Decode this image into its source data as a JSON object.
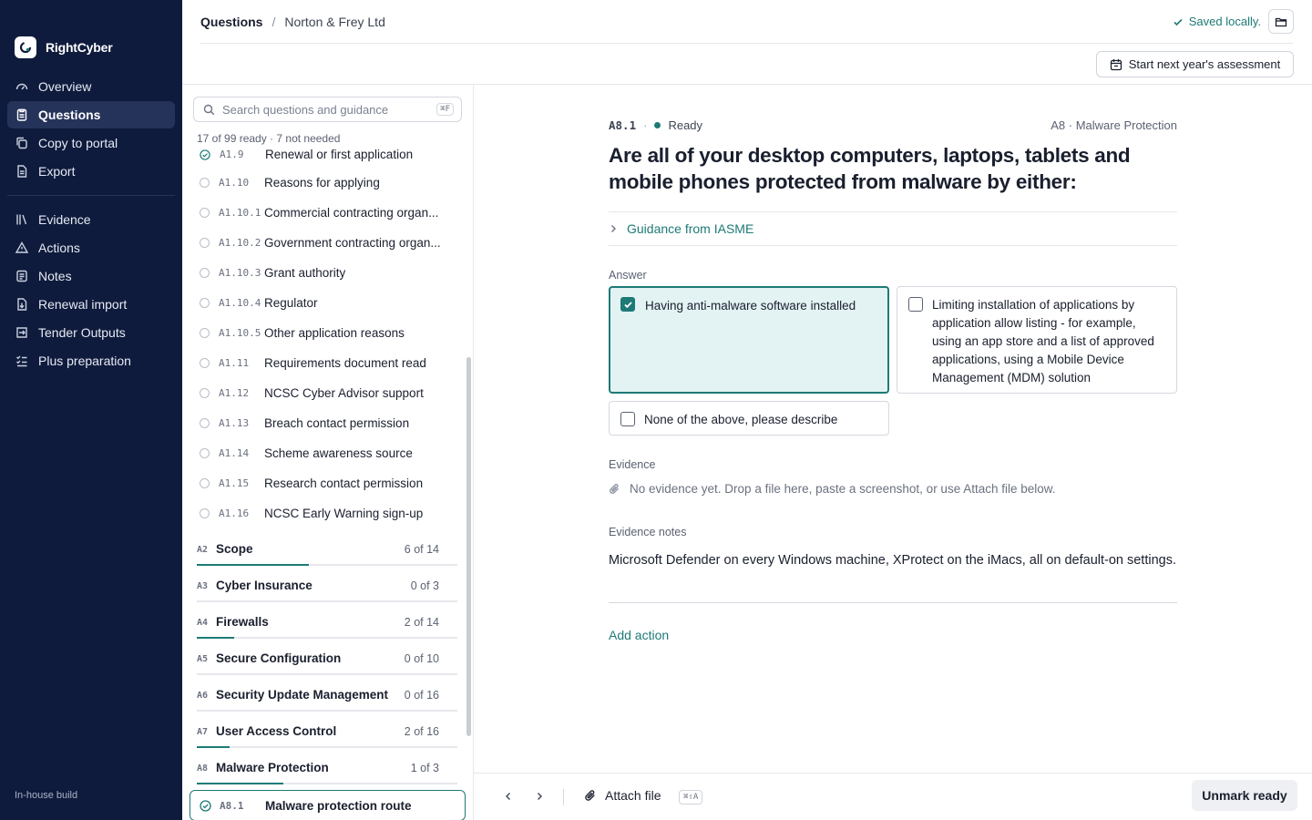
{
  "brand": {
    "name": "RightCyber"
  },
  "sidebar": {
    "nav_primary": [
      {
        "label": "Overview",
        "icon": "gauge-icon"
      },
      {
        "label": "Questions",
        "icon": "clipboard-icon",
        "active": true
      },
      {
        "label": "Copy to portal",
        "icon": "copy-icon"
      },
      {
        "label": "Export",
        "icon": "document-icon"
      }
    ],
    "nav_secondary": [
      {
        "label": "Evidence",
        "icon": "library-icon"
      },
      {
        "label": "Actions",
        "icon": "warning-icon"
      },
      {
        "label": "Notes",
        "icon": "note-icon"
      },
      {
        "label": "Renewal import",
        "icon": "import-icon"
      },
      {
        "label": "Tender Outputs",
        "icon": "output-icon"
      },
      {
        "label": "Plus preparation",
        "icon": "checklist-icon"
      }
    ],
    "footer": "In-house build"
  },
  "topbar": {
    "breadcrumb_current": "Questions",
    "breadcrumb_separator": "/",
    "client": "Norton & Frey Ltd",
    "saved_status": "Saved locally.",
    "start_button": "Start next year's assessment"
  },
  "question_panel": {
    "search_placeholder": "Search questions and guidance",
    "search_shortcut": "⌘F",
    "progress_summary": "17 of 99 ready · 7 not needed",
    "partial_row": {
      "id": "A1.9",
      "title": "Renewal or first application"
    },
    "questions": [
      {
        "id": "A1.10",
        "title": "Reasons for applying"
      },
      {
        "id": "A1.10.1",
        "title": "Commercial contracting organ..."
      },
      {
        "id": "A1.10.2",
        "title": "Government contracting organ..."
      },
      {
        "id": "A1.10.3",
        "title": "Grant authority"
      },
      {
        "id": "A1.10.4",
        "title": "Regulator"
      },
      {
        "id": "A1.10.5",
        "title": "Other application reasons"
      },
      {
        "id": "A1.11",
        "title": "Requirements document read"
      },
      {
        "id": "A1.12",
        "title": "NCSC Cyber Advisor support"
      },
      {
        "id": "A1.13",
        "title": "Breach contact permission"
      },
      {
        "id": "A1.14",
        "title": "Scheme awareness source"
      },
      {
        "id": "A1.15",
        "title": "Research contact permission"
      },
      {
        "id": "A1.16",
        "title": "NCSC Early Warning sign-up"
      }
    ],
    "sections": [
      {
        "id": "A2",
        "name": "Scope",
        "count": "6 of 14",
        "progress": 0.4286
      },
      {
        "id": "A3",
        "name": "Cyber Insurance",
        "count": "0 of 3",
        "progress": 0
      },
      {
        "id": "A4",
        "name": "Firewalls",
        "count": "2 of 14",
        "progress": 0.1429
      },
      {
        "id": "A5",
        "name": "Secure Configuration",
        "count": "0 of 10",
        "progress": 0
      },
      {
        "id": "A6",
        "name": "Security Update Management",
        "count": "0 of 16",
        "progress": 0
      },
      {
        "id": "A7",
        "name": "User Access Control",
        "count": "2 of 16",
        "progress": 0.125
      },
      {
        "id": "A8",
        "name": "Malware Protection",
        "count": "1 of 3",
        "progress": 0.3333
      }
    ],
    "active_question": {
      "id": "A8.1",
      "title": "Malware protection route"
    }
  },
  "main": {
    "question_id": "A8.1",
    "separator": "·",
    "status": "Ready",
    "section_tag": "A8 · Malware Protection",
    "title": "Are all of your desktop computers, laptops, tablets and mobile phones protected from malware by either:",
    "guidance_label": "Guidance from IASME",
    "answer_label": "Answer",
    "options": [
      {
        "label": "Having anti-malware software installed",
        "checked": true
      },
      {
        "label": "Limiting installation of applications by application allow listing - for example, using an app store and a list of approved applications, using a Mobile Device Management (MDM) solution",
        "checked": false
      },
      {
        "label": "None of the above, please describe",
        "checked": false
      }
    ],
    "evidence_label": "Evidence",
    "evidence_empty": "No evidence yet. Drop a file here, paste a screenshot, or use Attach file below.",
    "notes_label": "Evidence notes",
    "notes_value": "Microsoft Defender on every Windows machine, XProtect on the iMacs, all on default-on settings.",
    "add_action": "Add action"
  },
  "bottombar": {
    "attach_label": "Attach file",
    "attach_shortcut": "⌘⇧A",
    "unmark_label": "Unmark ready"
  },
  "colors": {
    "sidebar_bg": "#0f1b3d",
    "accent": "#1d7a76",
    "checked_bg": "#e3f2f3"
  }
}
